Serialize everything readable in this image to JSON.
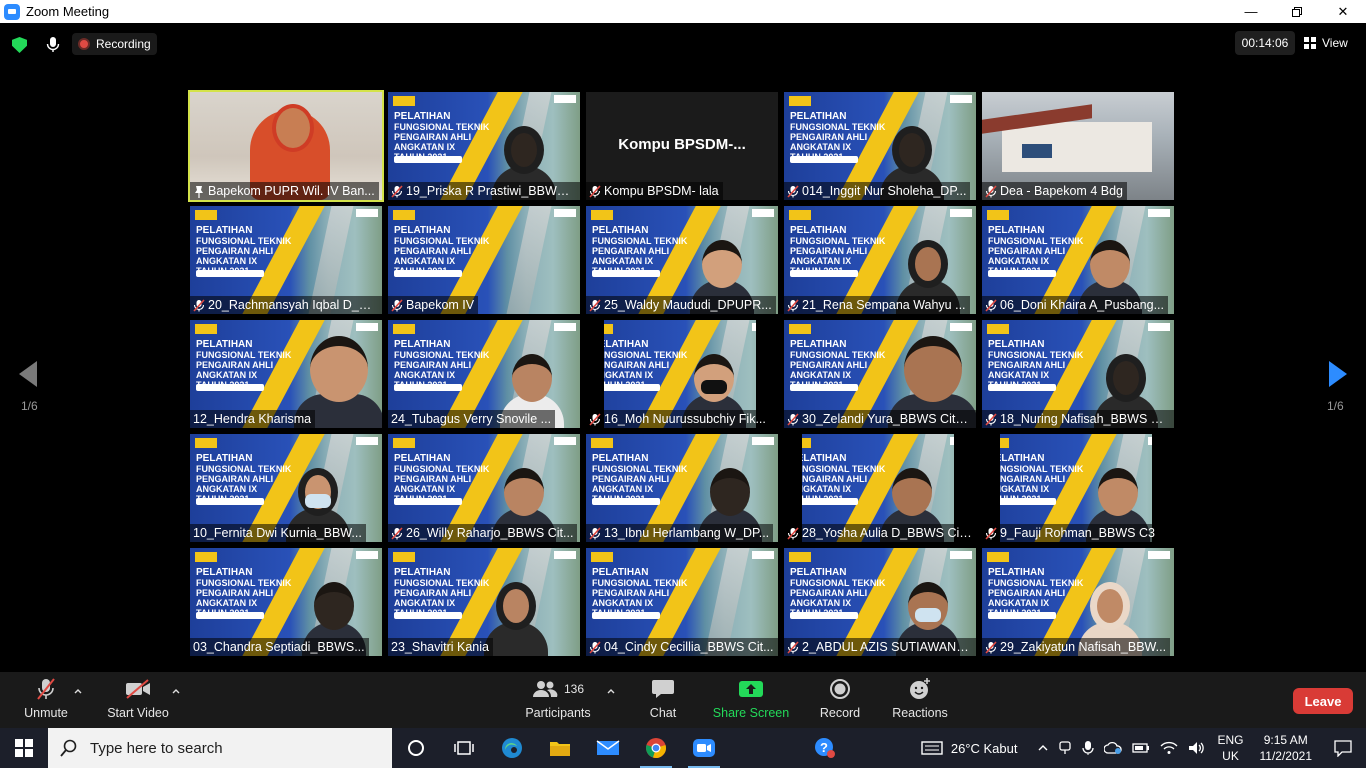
{
  "window": {
    "title": "Zoom Meeting",
    "min_glyph": "—",
    "max_glyph": "❐",
    "close_glyph": "✕"
  },
  "topbar": {
    "recording_label": "Recording",
    "timer": "00:14:06",
    "view_label": "View"
  },
  "pagination": {
    "left": "1/6",
    "right": "1/6"
  },
  "tiles": [
    {
      "name": "Bapekom PUPR Wil. IV Ban...",
      "bg": "room",
      "pinned": true,
      "muted": false,
      "active": true
    },
    {
      "name": "19_Priska R Prastiwi_BBWS ...",
      "bg": "banner",
      "person": "hijab-dark",
      "muted": true
    },
    {
      "name": "Kompu BPSDM- lala",
      "bg": "dark",
      "center_text": "Kompu  BPSDM-...",
      "muted": true
    },
    {
      "name": "014_Inggit Nur Sholeha_DP...",
      "bg": "banner",
      "person": "hijab-dark-glasses",
      "muted": true
    },
    {
      "name": "Dea - Bapekom 4 Bdg",
      "bg": "building",
      "muted": true
    },
    {
      "name": "20_Rachmansyah Iqbal D_D...",
      "bg": "banner",
      "muted": true
    },
    {
      "name": "Bapekom IV",
      "bg": "banner",
      "muted": true
    },
    {
      "name": "25_Waldy Maududi_DPUPR...",
      "bg": "banner",
      "person": "man-down",
      "muted": true
    },
    {
      "name": "21_Rena Sempana Wahyu ...",
      "bg": "banner",
      "person": "hijab-small",
      "muted": true
    },
    {
      "name": "06_Doni Khaira A_Pusbang...",
      "bg": "banner",
      "person": "man",
      "muted": true
    },
    {
      "name": "12_Hendra Kharisma",
      "bg": "banner",
      "person": "man-close",
      "muted": false
    },
    {
      "name": "24_Tubagus Verry Snovile ...",
      "bg": "banner",
      "person": "man-shirt",
      "muted": false
    },
    {
      "name": "16_Moh Nuurussubchiy Fik...",
      "bg": "banner-cropped",
      "person": "man-mask",
      "muted": true
    },
    {
      "name": "30_Zelandi Yura_BBWS Cita...",
      "bg": "banner",
      "person": "man-close",
      "muted": true
    },
    {
      "name": "18_Nuring Nafisah_BBWS C...",
      "bg": "banner",
      "person": "hijab-dark",
      "muted": true
    },
    {
      "name": "10_Fernita Dwi Kurnia_BBW...",
      "bg": "banner",
      "person": "hijab-mask",
      "muted": false
    },
    {
      "name": "26_Willy Raharjo_BBWS Cit...",
      "bg": "banner",
      "person": "man",
      "muted": true
    },
    {
      "name": "13_Ibnu Herlambang W_DP...",
      "bg": "banner",
      "person": "man-dark",
      "muted": true
    },
    {
      "name": "28_Yosha Aulia D_BBWS Cit...",
      "bg": "banner-cropped",
      "person": "hands",
      "muted": true
    },
    {
      "name": "9_Fauji Rohman_BBWS C3",
      "bg": "banner-cropped",
      "person": "man",
      "muted": true
    },
    {
      "name": "03_Chandra Septiadi_BBWS...",
      "bg": "banner",
      "person": "man-dark",
      "muted": false
    },
    {
      "name": "23_Shavitri Kania",
      "bg": "banner",
      "person": "hijab-small",
      "muted": false
    },
    {
      "name": "04_Cindy Cecillia_BBWS Cit...",
      "bg": "banner",
      "muted": true
    },
    {
      "name": "2_ABDUL AZIS SUTIAWAN_...",
      "bg": "banner",
      "person": "man-mask",
      "muted": true
    },
    {
      "name": "29_Zakiyatun Nafisah_BBW...",
      "bg": "banner",
      "person": "hijab-light-glasses",
      "muted": true
    }
  ],
  "banner": {
    "line1": "PELATIHAN",
    "line2": "FUNGSIONAL TEKNIK PENGAIRAN AHLI",
    "line3": "ANGKATAN IX",
    "line4": "TAHUN 2021"
  },
  "controls": {
    "unmute": "Unmute",
    "start_video": "Start Video",
    "participants": "Participants",
    "participants_count": "136",
    "chat": "Chat",
    "share_screen": "Share Screen",
    "record": "Record",
    "reactions": "Reactions",
    "leave": "Leave"
  },
  "taskbar": {
    "search_placeholder": "Type here to search",
    "weather": "26°C  Kabut",
    "lang1": "ENG",
    "lang2": "UK",
    "time": "9:15 AM",
    "date": "11/2/2021"
  },
  "colors": {
    "accent_green": "#23d959",
    "leave_red": "#d93b36",
    "active_speaker": "#d4e34a",
    "zoom_blue": "#2d8cff"
  }
}
